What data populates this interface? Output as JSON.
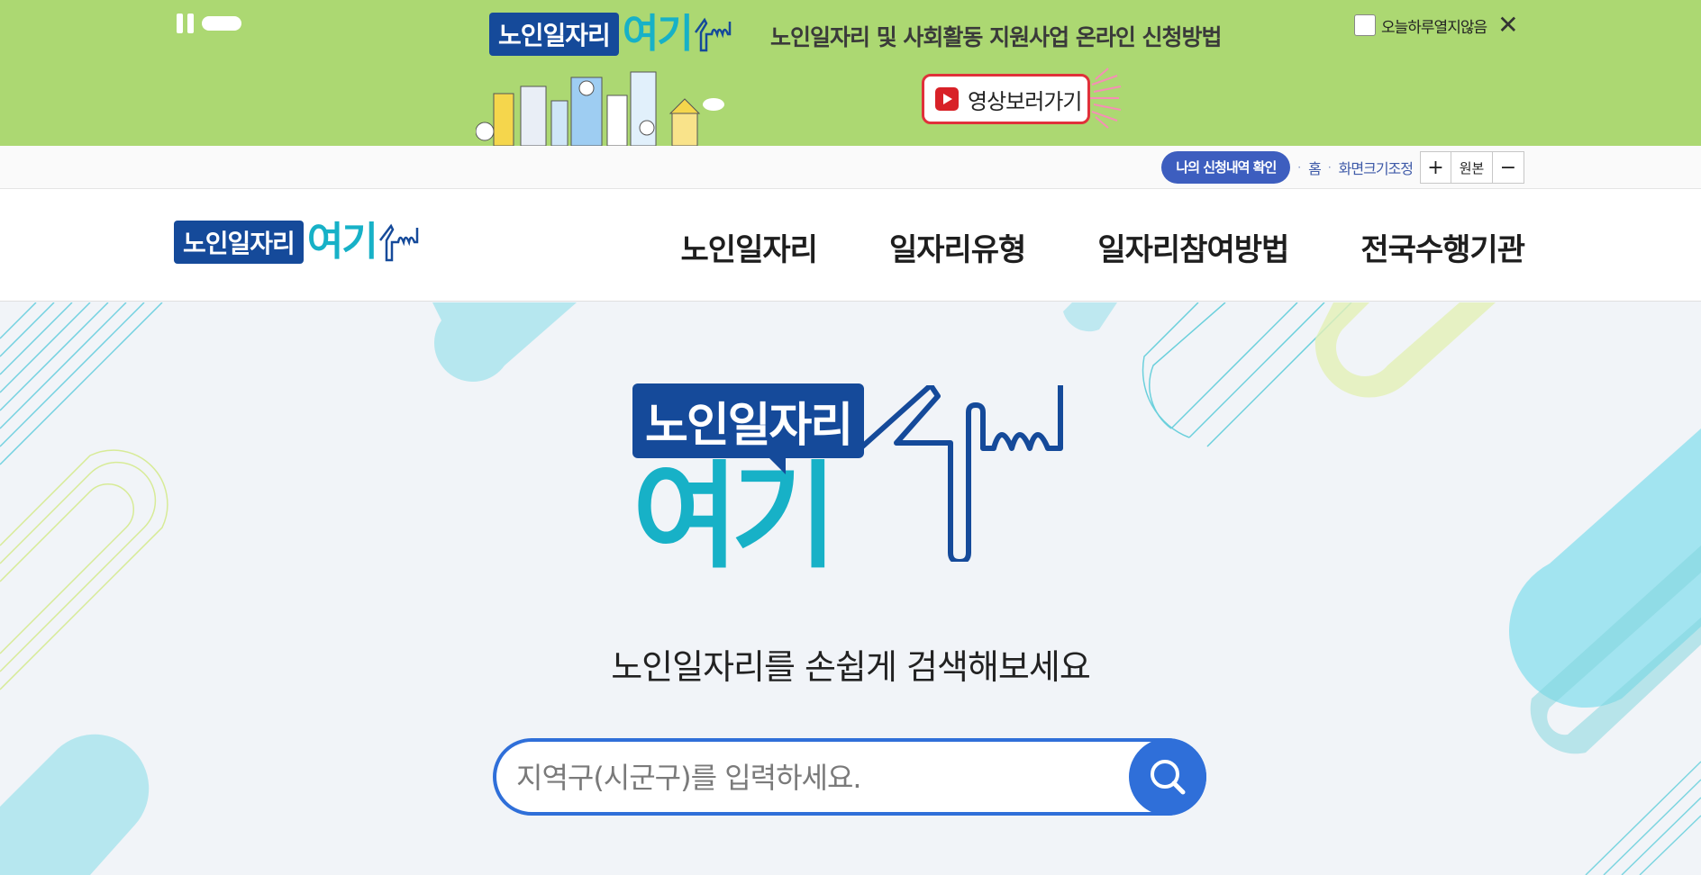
{
  "promo": {
    "logo_box": "노인일자리",
    "logo_teal": "여기",
    "title": "노인일자리 및 사회활동 지원사업 온라인 신청방법",
    "video_button": "영상보러가기",
    "close_today_label": "오늘하루열지않음"
  },
  "utility": {
    "apply_check": "나의 신청내역 확인",
    "home": "홈",
    "zoom_label": "화면크기조정",
    "zoom_in": "+",
    "zoom_reset": "원본",
    "zoom_out": "−"
  },
  "header": {
    "logo_box": "노인일자리",
    "logo_teal": "여기",
    "nav": [
      {
        "label": "노인일자리"
      },
      {
        "label": "일자리유형"
      },
      {
        "label": "일자리참여방법"
      },
      {
        "label": "전국수행기관"
      }
    ]
  },
  "hero": {
    "logo_box": "노인일자리",
    "logo_teal": "여기",
    "subtitle": "노인일자리를 손쉽게 검색해보세요",
    "search_placeholder": "지역구(시군구)를 입력하세요."
  },
  "colors": {
    "banner_bg": "#acd872",
    "brand_navy": "#154a9a",
    "brand_teal": "#17b1c7",
    "accent_blue": "#2f6fd9",
    "apply_button": "#3d5ebf",
    "video_red": "#e0313a"
  },
  "icons": [
    "pause-icon",
    "youtube-play-icon",
    "close-icon",
    "search-icon",
    "pointing-finger-icon"
  ]
}
